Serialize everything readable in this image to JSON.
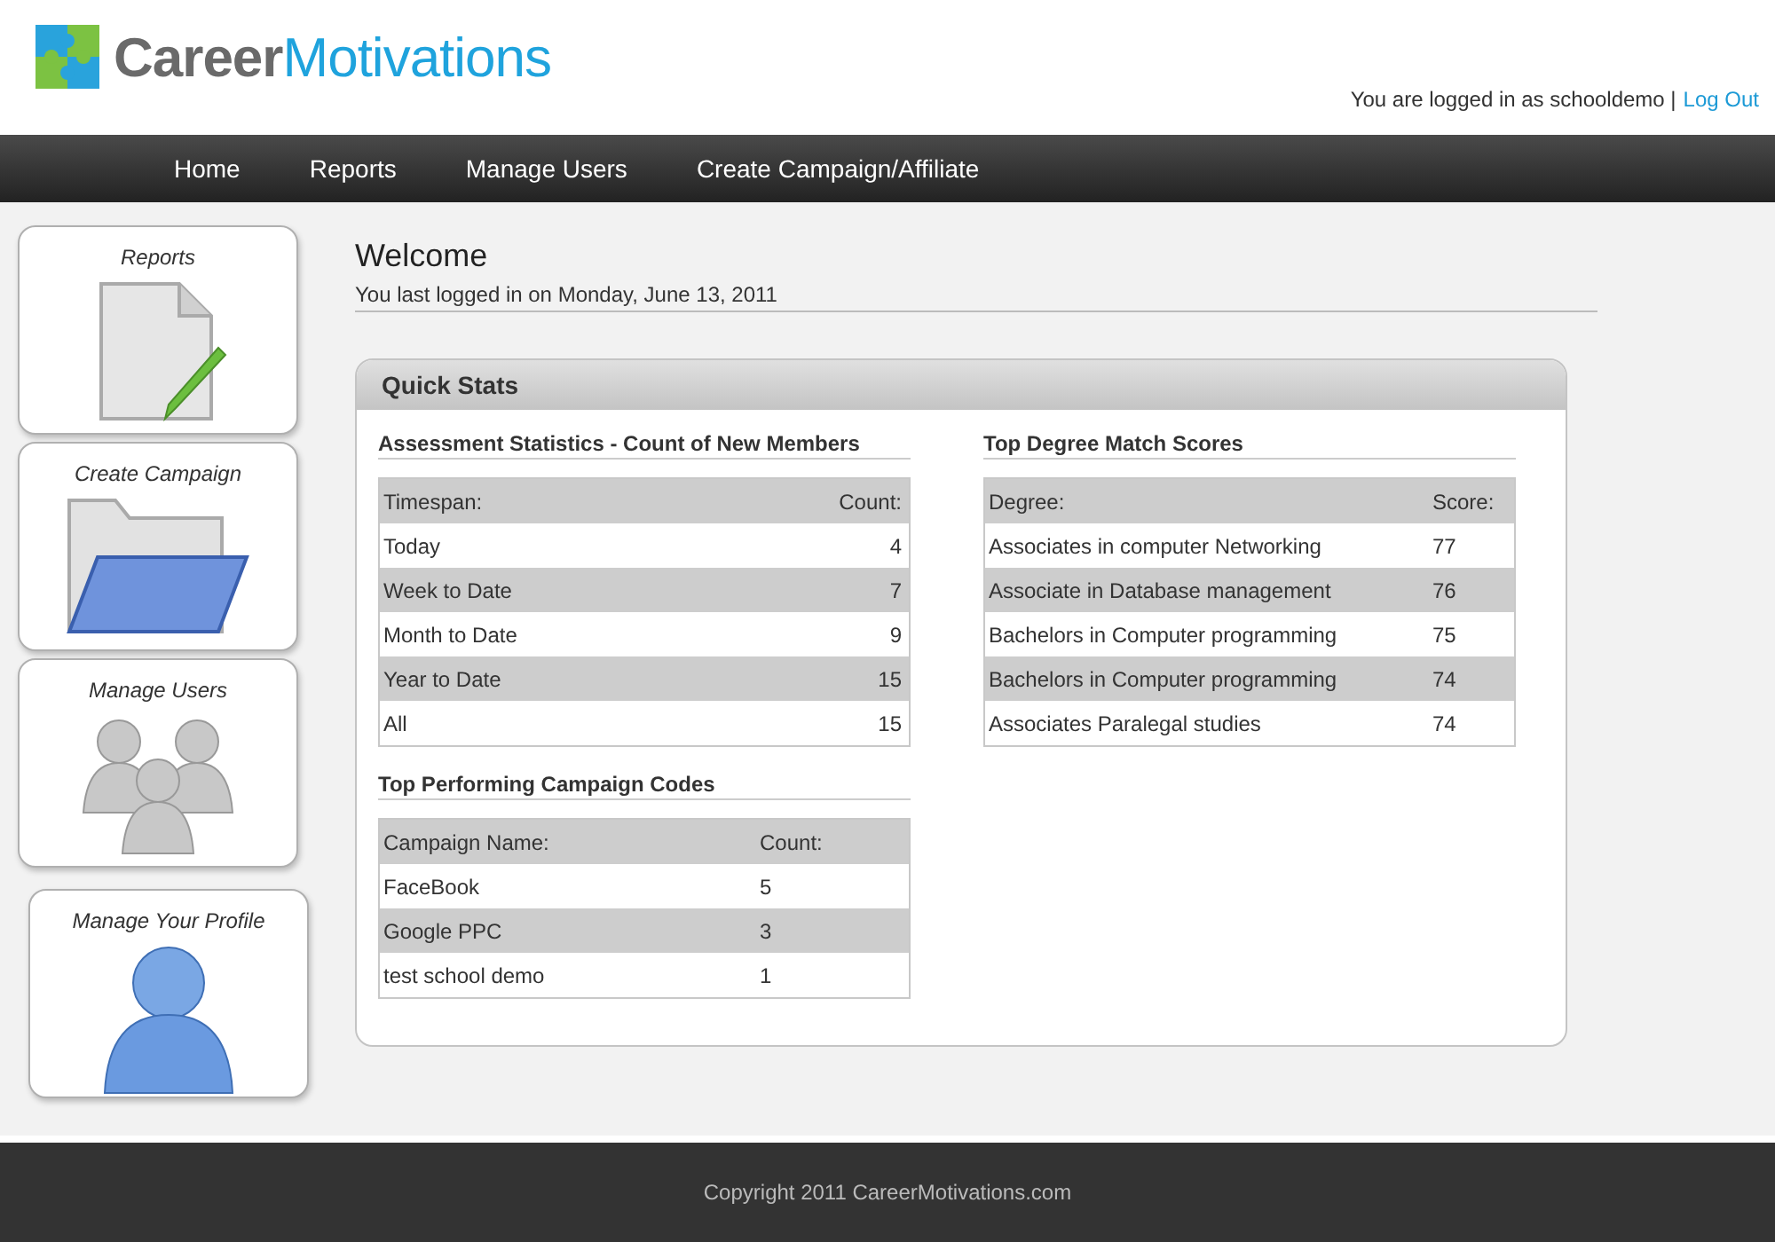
{
  "logo": {
    "word_1": "Career",
    "word_2": "Motivations"
  },
  "login": {
    "text": "You are logged in as schooldemo |",
    "link": "Log Out"
  },
  "nav": [
    {
      "label": "Home"
    },
    {
      "label": "Reports"
    },
    {
      "label": "Manage Users"
    },
    {
      "label": "Create Campaign/Affiliate"
    }
  ],
  "sidebar": [
    {
      "label": "Reports",
      "kind": "report"
    },
    {
      "label": "Create Campaign",
      "kind": "folder"
    },
    {
      "label": "Manage Users",
      "kind": "users"
    },
    {
      "label": "Manage Your Profile",
      "kind": "profile"
    }
  ],
  "welcome": {
    "title": "Welcome",
    "subtitle": "You last logged in on Monday, June 13, 2011"
  },
  "quick_stats": {
    "title": "Quick Stats",
    "assessment": {
      "title": "Assessment Statistics - Count of New Members",
      "columns": [
        "Timespan:",
        "Count:"
      ],
      "rows": [
        [
          "Today",
          "4"
        ],
        [
          "Week to Date",
          "7"
        ],
        [
          "Month to Date",
          "9"
        ],
        [
          "Year to Date",
          "15"
        ],
        [
          "All",
          "15"
        ]
      ]
    },
    "campaigns": {
      "title": "Top Performing Campaign Codes",
      "columns": [
        "Campaign Name:",
        "Count:"
      ],
      "rows": [
        [
          "FaceBook",
          "5"
        ],
        [
          "Google PPC",
          "3"
        ],
        [
          "test school demo",
          "1"
        ]
      ]
    },
    "degrees": {
      "title": "Top Degree Match Scores",
      "columns": [
        "Degree:",
        "Score:"
      ],
      "rows": [
        [
          "Associates in computer Networking",
          "77"
        ],
        [
          "Associate in Database management",
          "76"
        ],
        [
          "Bachelors in Computer programming",
          "75"
        ],
        [
          "Bachelors in Computer programming",
          "74"
        ],
        [
          "Associates Paralegal studies",
          "74"
        ]
      ]
    }
  },
  "footer": "Copyright 2011 CareerMotivations.com"
}
